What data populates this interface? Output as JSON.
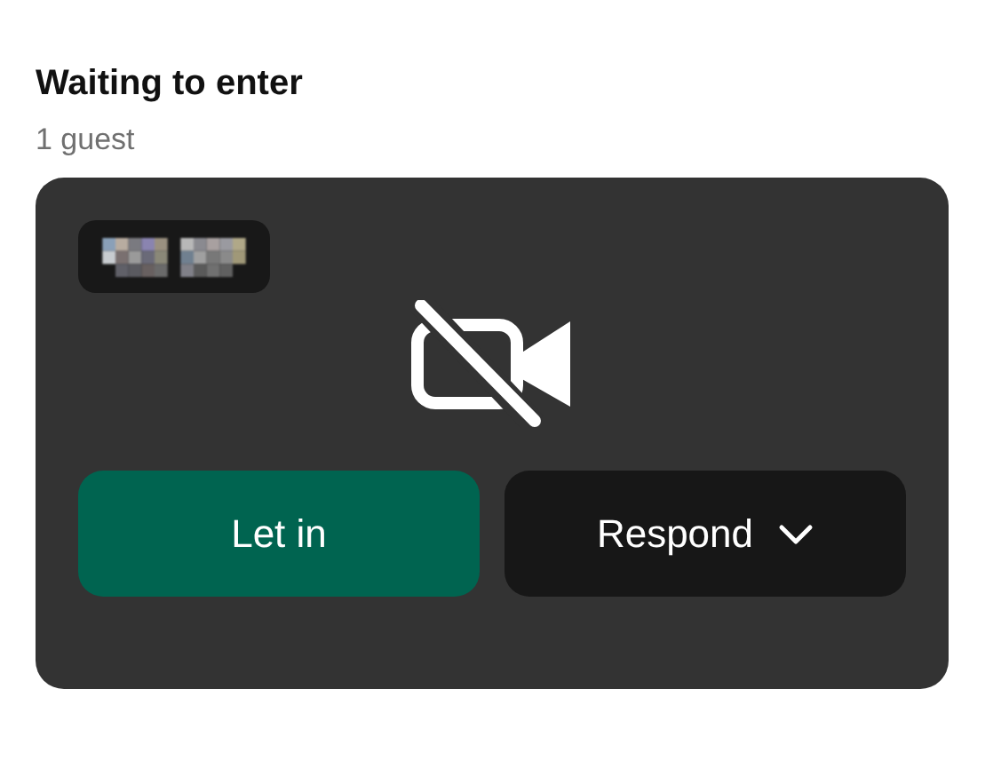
{
  "section": {
    "title": "Waiting to enter",
    "count": "1 guest"
  },
  "guest": {
    "camera_off": true
  },
  "actions": [
    {
      "kind": "primary",
      "label": "Let in"
    },
    {
      "kind": "menu",
      "label": "Respond"
    }
  ]
}
